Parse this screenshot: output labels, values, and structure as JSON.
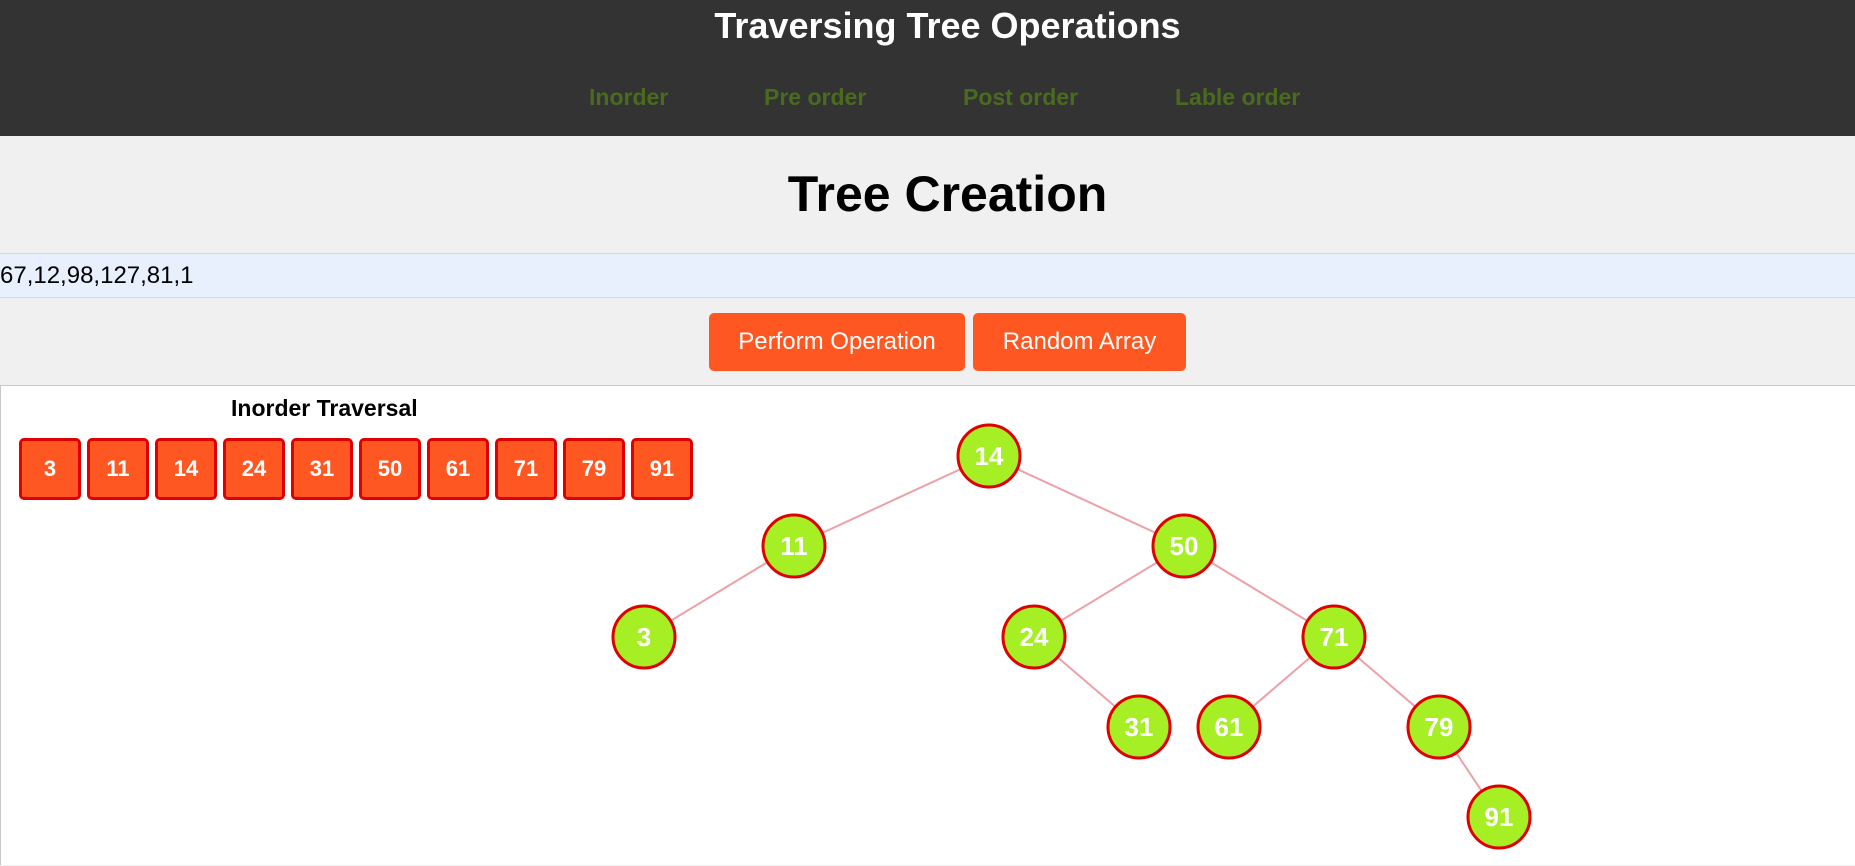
{
  "header": {
    "title": "Traversing Tree Operations",
    "nav": [
      "Inorder",
      "Pre order",
      "Post order",
      "Lable order"
    ]
  },
  "main": {
    "title": "Tree Creation",
    "input_value": "67,12,98,127,81,1",
    "buttons": {
      "perform": "Perform Operation",
      "random": "Random Array"
    }
  },
  "traversal": {
    "title": "Inorder Traversal",
    "result": [
      "3",
      "11",
      "14",
      "24",
      "31",
      "50",
      "61",
      "71",
      "79",
      "91"
    ]
  },
  "tree": {
    "nodes": [
      "14",
      "11",
      "50",
      "3",
      "24",
      "71",
      "31",
      "61",
      "79",
      "91"
    ],
    "edges": [
      [
        "14",
        "11"
      ],
      [
        "14",
        "50"
      ],
      [
        "11",
        "3"
      ],
      [
        "50",
        "24"
      ],
      [
        "50",
        "71"
      ],
      [
        "24",
        "31"
      ],
      [
        "71",
        "61"
      ],
      [
        "71",
        "79"
      ],
      [
        "79",
        "91"
      ]
    ]
  },
  "colors": {
    "header_bg": "#333333",
    "nav_link": "#4a6b1e",
    "accent": "#ff5722",
    "node_fill": "#a6ef24",
    "node_stroke": "#e00000",
    "edge": "#eda0a8"
  }
}
